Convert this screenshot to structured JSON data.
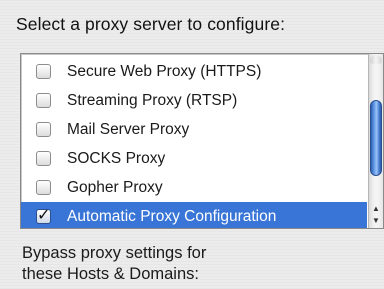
{
  "heading": "Select a proxy server to configure:",
  "proxies": [
    {
      "label": "Secure Web Proxy (HTTPS)",
      "checked": false,
      "selected": false
    },
    {
      "label": "Streaming Proxy (RTSP)",
      "checked": false,
      "selected": false
    },
    {
      "label": "Mail Server Proxy",
      "checked": false,
      "selected": false
    },
    {
      "label": "SOCKS Proxy",
      "checked": false,
      "selected": false
    },
    {
      "label": "Gopher Proxy",
      "checked": false,
      "selected": false
    },
    {
      "label": "Automatic Proxy Configuration",
      "checked": true,
      "selected": true
    }
  ],
  "scroll": {
    "up_arrow": "▲",
    "down_arrow": "▼"
  },
  "checkmark": "✓",
  "bypass": {
    "line1": "Bypass proxy settings for",
    "line2": "these Hosts & Domains:"
  },
  "colors": {
    "selection": "#3875d7",
    "scroll_thumb": "#4b82d6"
  }
}
